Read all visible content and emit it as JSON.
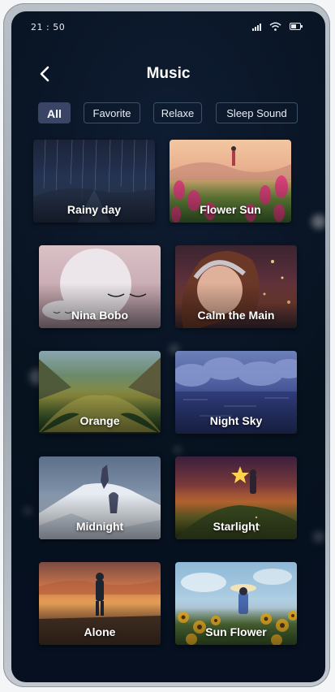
{
  "status_bar": {
    "time": "21 : 50"
  },
  "header": {
    "title": "Music"
  },
  "filters": [
    {
      "label": "All",
      "active": true
    },
    {
      "label": "Favorite",
      "active": false
    },
    {
      "label": "Relaxe",
      "active": false
    },
    {
      "label": "Sleep Sound",
      "active": false
    }
  ],
  "tracks": [
    {
      "title": "Rainy day"
    },
    {
      "title": "Flower Sun"
    },
    {
      "title": "Nina Bobo"
    },
    {
      "title": "Calm the Main"
    },
    {
      "title": "Orange"
    },
    {
      "title": "Night Sky"
    },
    {
      "title": "Midnight"
    },
    {
      "title": "Starlight"
    },
    {
      "title": "Alone"
    },
    {
      "title": "Sun Flower"
    }
  ],
  "colors": {
    "background": "#07121f",
    "chip_active": "#3a4566",
    "chip_border": "#3f4f66",
    "text": "#ffffff"
  }
}
